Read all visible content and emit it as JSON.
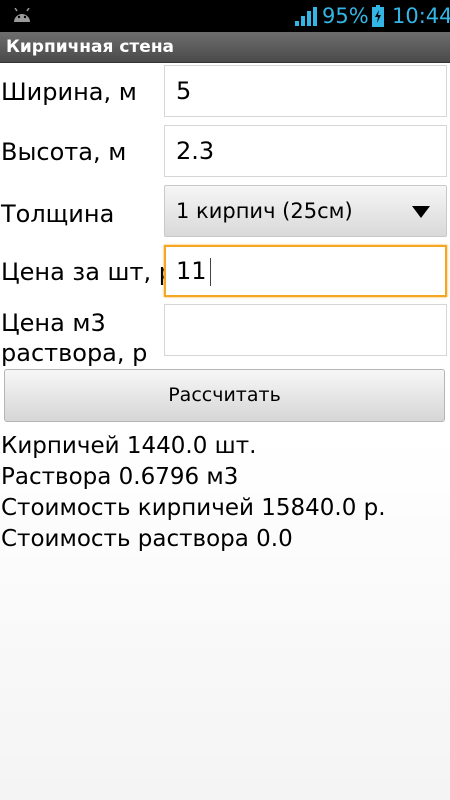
{
  "status_bar": {
    "battery_percent": "95%",
    "time": "10:44",
    "icons": [
      "android-icon",
      "signal-icon",
      "battery-charging-icon"
    ],
    "accent_color": "#33b5e5"
  },
  "app": {
    "title": "Кирпичная стена"
  },
  "form": {
    "width": {
      "label": "Ширина, м",
      "value": "5"
    },
    "height": {
      "label": "Высота, м",
      "value": "2.3"
    },
    "thickness": {
      "label": "Толщина",
      "selected": "1 кирпич (25см)"
    },
    "price_per_piece": {
      "label": "Цена за шт, р",
      "value": "11"
    },
    "mortar_price": {
      "label_line1": "Цена м3",
      "label_line2": "раствора, р",
      "value": ""
    },
    "calculate_label": "Рассчитать",
    "focus_color": "#f5a623"
  },
  "results": {
    "bricks": "Кирпичей 1440.0 шт.",
    "mortar": "Раствора 0.6796 м3",
    "bricks_cost": "Стоимость кирпичей 15840.0 р.",
    "mortar_cost": "Стоимость раствора 0.0"
  }
}
